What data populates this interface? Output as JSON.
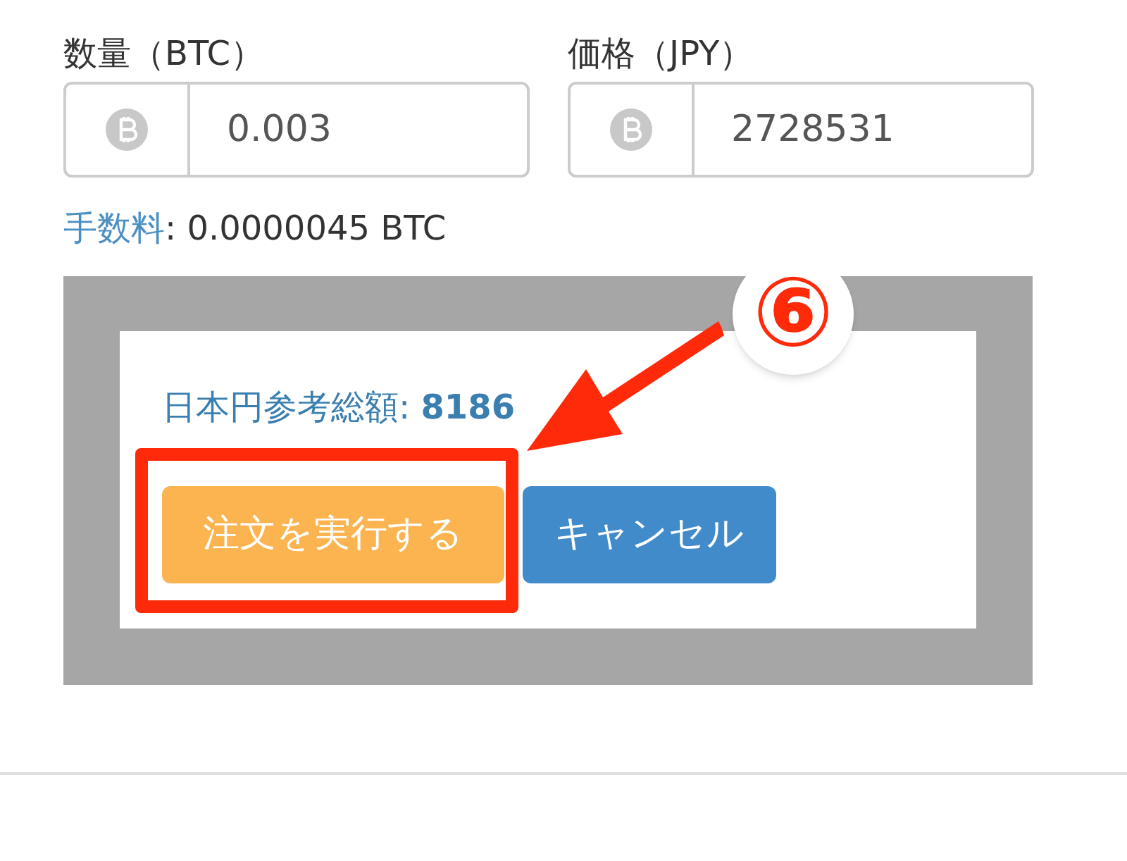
{
  "fields": [
    {
      "label": "数量（BTC）",
      "value": "0.003"
    },
    {
      "label": "価格（JPY）",
      "value": "2728531"
    }
  ],
  "fee": {
    "label": "手数料",
    "value": ": 0.0000045 BTC"
  },
  "dialog": {
    "total_label": "日本円参考総額: ",
    "total_value": "8186",
    "buttons": [
      {
        "label": "注文を実行する",
        "kind": "primary"
      },
      {
        "label": "キャンセル",
        "kind": "secondary"
      }
    ]
  },
  "annotation": {
    "badge": "⑥"
  }
}
